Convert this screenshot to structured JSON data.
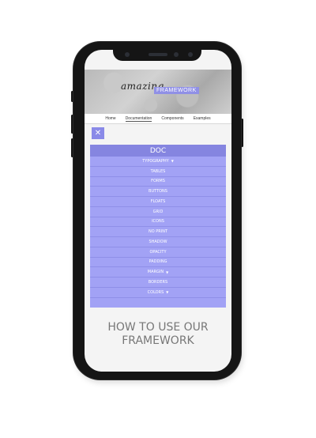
{
  "header": {
    "logo_script": "amazing",
    "logo_box": "FRAMEWORK"
  },
  "nav": {
    "items": [
      "Home",
      "Documentation",
      "Components",
      "Examples"
    ],
    "active": "Documentation"
  },
  "close": {
    "icon": "close-icon",
    "glyph": "✕"
  },
  "menu": {
    "title": "DOC",
    "items": [
      {
        "label": "TYPOGRAPHY",
        "dropdown": true
      },
      {
        "label": "TABLES"
      },
      {
        "label": "FORMS"
      },
      {
        "label": "BUTTONS"
      },
      {
        "label": "FLOATS"
      },
      {
        "label": "GRID"
      },
      {
        "label": "ICONS"
      },
      {
        "label": "NO PRINT"
      },
      {
        "label": "SHADOW"
      },
      {
        "label": "OPACITY"
      },
      {
        "label": "PADDING"
      },
      {
        "label": "MARGIN",
        "dropdown": true
      },
      {
        "label": "BORDERS"
      },
      {
        "label": "COLORS",
        "dropdown": true
      }
    ],
    "caret_glyph": "▼"
  },
  "main": {
    "heading_line1": "HOW TO USE OUR",
    "heading_line2": "FRAMEWORK"
  },
  "colors": {
    "accent": "#8585e0",
    "menu_bg": "#a2a2f5",
    "phone_frame": "#151515"
  }
}
